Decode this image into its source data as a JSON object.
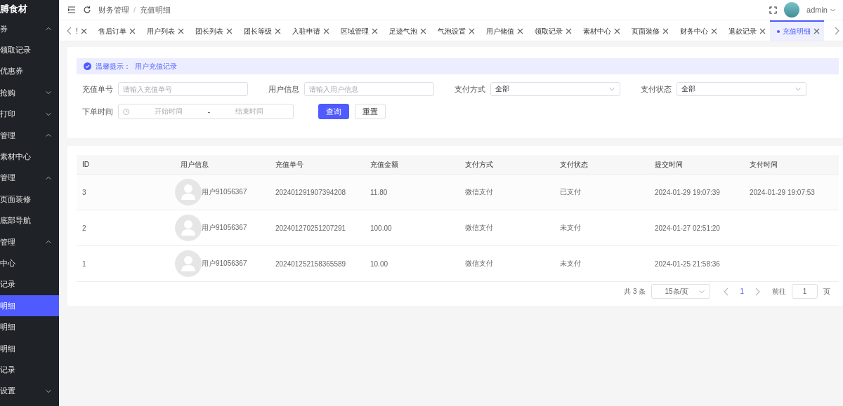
{
  "sidebar": {
    "title": "膊食材",
    "items": [
      {
        "label": "券",
        "kind": "group",
        "expanded": true,
        "selected": false
      },
      {
        "label": "领取记录",
        "kind": "item",
        "selected": false
      },
      {
        "label": "优惠券",
        "kind": "item",
        "selected": false
      },
      {
        "label": "抢购",
        "kind": "group",
        "expanded": false,
        "selected": false
      },
      {
        "label": "打印",
        "kind": "group",
        "expanded": false,
        "selected": false
      },
      {
        "label": "管理",
        "kind": "group",
        "expanded": true,
        "selected": false
      },
      {
        "label": "素材中心",
        "kind": "item",
        "selected": false
      },
      {
        "label": "管理",
        "kind": "group",
        "expanded": true,
        "selected": false
      },
      {
        "label": "页面装修",
        "kind": "item",
        "selected": false
      },
      {
        "label": "底部导航",
        "kind": "item",
        "selected": false
      },
      {
        "label": "管理",
        "kind": "group",
        "expanded": true,
        "selected": false
      },
      {
        "label": "中心",
        "kind": "item",
        "selected": false
      },
      {
        "label": "记录",
        "kind": "item",
        "selected": false
      },
      {
        "label": "明细",
        "kind": "item",
        "selected": true
      },
      {
        "label": "明细",
        "kind": "item",
        "selected": false
      },
      {
        "label": "明细",
        "kind": "item",
        "selected": false
      },
      {
        "label": "记录",
        "kind": "item",
        "selected": false
      },
      {
        "label": "设置",
        "kind": "group",
        "expanded": false,
        "selected": false
      }
    ]
  },
  "header": {
    "breadcrumb": [
      "财务管理",
      "充值明细"
    ],
    "breadcrumb_separator": "/",
    "user": "admin"
  },
  "tabs": [
    {
      "label": "!",
      "selected": false
    },
    {
      "label": "售后订单",
      "selected": false
    },
    {
      "label": "用户列表",
      "selected": false
    },
    {
      "label": "团长列表",
      "selected": false
    },
    {
      "label": "团长等级",
      "selected": false
    },
    {
      "label": "入驻申请",
      "selected": false
    },
    {
      "label": "区域管理",
      "selected": false
    },
    {
      "label": "足迹气泡",
      "selected": false
    },
    {
      "label": "气泡设置",
      "selected": false
    },
    {
      "label": "用户储值",
      "selected": false
    },
    {
      "label": "领取记录",
      "selected": false
    },
    {
      "label": "素材中心",
      "selected": false
    },
    {
      "label": "页面装修",
      "selected": false
    },
    {
      "label": "财务中心",
      "selected": false
    },
    {
      "label": "退款记录",
      "selected": false
    },
    {
      "label": "充值明细",
      "selected": true
    }
  ],
  "notice": {
    "label": "温馨提示：",
    "text": "用户充值记录"
  },
  "filters": [
    {
      "label": "充值单号",
      "kind": "input",
      "placeholder": "请输入充值单号"
    },
    {
      "label": "用户信息",
      "kind": "input",
      "placeholder": "请输入用户信息"
    },
    {
      "label": "支付方式",
      "kind": "select",
      "value": "全部"
    },
    {
      "label": "支付状态",
      "kind": "select",
      "value": "全部"
    }
  ],
  "date_filter": {
    "label": "下单时间",
    "start_placeholder": "开始时间",
    "separator": "-",
    "end_placeholder": "结束时间"
  },
  "buttons": [
    {
      "label": "查询",
      "kind": "primary"
    },
    {
      "label": "重置",
      "kind": "default"
    }
  ],
  "table": {
    "columns": [
      "ID",
      "用户信息",
      "充值单号",
      "充值金额",
      "支付方式",
      "支付状态",
      "提交时间",
      "支付时间"
    ],
    "rows": [
      {
        "id": "3",
        "user": "用户91056367",
        "order_no": "202401291907394208",
        "amount": "11.80",
        "method": "微信支付",
        "status": "已支付",
        "submitted": "2024-01-29 19:07:39",
        "paid": "2024-01-29 19:07:53"
      },
      {
        "id": "2",
        "user": "用户91056367",
        "order_no": "202401270251207291",
        "amount": "100.00",
        "method": "微信支付",
        "status": "未支付",
        "submitted": "2024-01-27 02:51:20"
      },
      {
        "id": "1",
        "user": "用户91056367",
        "order_no": "202401252158365589",
        "amount": "10.00",
        "method": "微信支付",
        "status": "未支付",
        "submitted": "2024-01-25 21:58:36"
      }
    ]
  },
  "pagination": {
    "total": "共 3 条",
    "page_size": "15条/页",
    "pages": [
      {
        "label": "1",
        "selected": true
      }
    ],
    "goto_label": "前往",
    "goto_value": "1",
    "page_suffix": "页"
  }
}
